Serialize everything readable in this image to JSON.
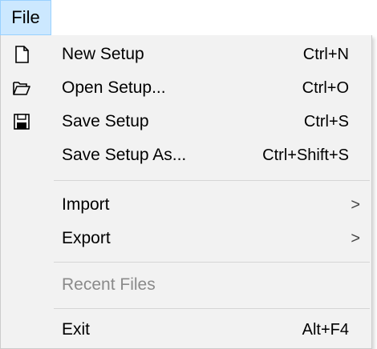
{
  "menubar": {
    "file_label": "File"
  },
  "menu": {
    "items": [
      {
        "label": "New Setup",
        "shortcut": "Ctrl+N",
        "icon": "new-file-icon"
      },
      {
        "label": "Open Setup...",
        "shortcut": "Ctrl+O",
        "icon": "open-folder-icon"
      },
      {
        "label": "Save Setup",
        "shortcut": "Ctrl+S",
        "icon": "save-icon"
      },
      {
        "label": "Save Setup As...",
        "shortcut": "Ctrl+Shift+S"
      },
      {
        "label": "Import",
        "submenu": true
      },
      {
        "label": "Export",
        "submenu": true
      },
      {
        "label": "Recent Files",
        "disabled": true
      },
      {
        "label": "Exit",
        "shortcut": "Alt+F4"
      }
    ],
    "submenu_arrow": ">"
  },
  "colors": {
    "menubar_highlight": "#cce8ff",
    "menu_background": "#f2f2f2",
    "disabled_text": "#8a8a8a"
  }
}
